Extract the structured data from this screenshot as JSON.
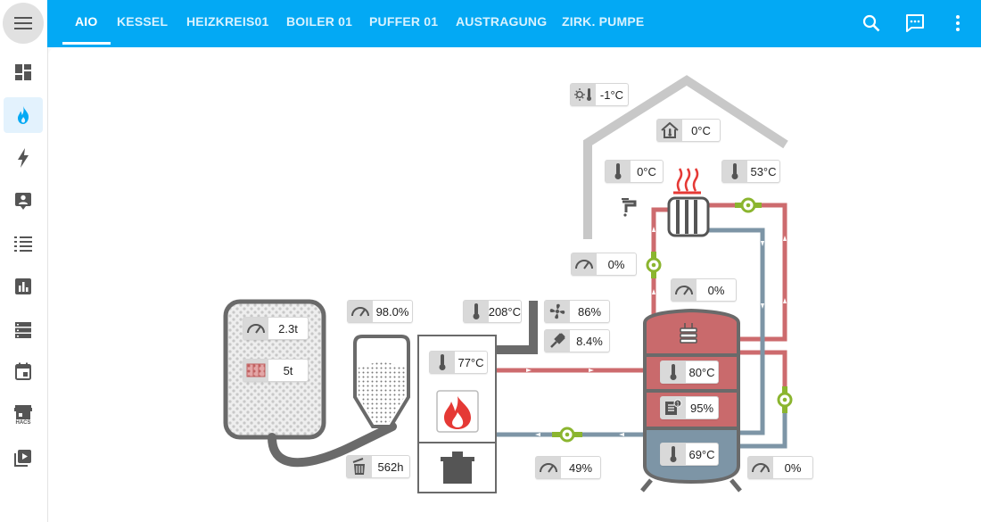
{
  "sidebar": {
    "items": [
      {
        "name": "menu",
        "icon": "hamburger-menu-icon"
      },
      {
        "name": "overview",
        "icon": "dashboard-icon"
      },
      {
        "name": "heating",
        "icon": "fire-icon"
      },
      {
        "name": "energy",
        "icon": "lightning-icon"
      },
      {
        "name": "persons",
        "icon": "account-box-icon"
      },
      {
        "name": "logbook",
        "icon": "list-icon"
      },
      {
        "name": "history",
        "icon": "chart-box-icon"
      },
      {
        "name": "server",
        "icon": "server-icon"
      },
      {
        "name": "calendar",
        "icon": "calendar-icon"
      },
      {
        "name": "hacs",
        "icon": "hacs-store-icon",
        "label": "HACS"
      },
      {
        "name": "media",
        "icon": "play-box-icon"
      }
    ]
  },
  "tabs": [
    "AIO",
    "KESSEL",
    "HEIZKREIS01",
    "BOILER 01",
    "PUFFER 01",
    "AUSTRAGUNG",
    "ZIRK. PUMPE"
  ],
  "toolbar": {
    "icons": [
      "search-icon",
      "message-icon",
      "more-vert-icon"
    ]
  },
  "colors": {
    "accent": "#03a9f4",
    "hot": "#cd6b6e",
    "cold": "#7d95a6",
    "pump": "#8bb52f",
    "flame": "#e53935"
  },
  "sensors": {
    "outside_temp": "-1°C",
    "room_temp": "0°C",
    "flow_temp_hk": "0°C",
    "return_temp_hk": "53°C",
    "mixer_pos": "0%",
    "pump_hk_speed": "0%",
    "pellet_store_level": "2.3t",
    "pellet_store_capacity": "5t",
    "hopper_level": "98.0%",
    "flue_gas_temp": "208°C",
    "fan_speed": "86%",
    "oxygen": "8.4%",
    "boiler_temp": "77°C",
    "operating_hours": "562h",
    "buffer_top": "80°C",
    "buffer_charge": "95%",
    "buffer_bottom": "69°C",
    "pump_boiler_speed": "49%",
    "pump_buffer_speed": "0%"
  }
}
